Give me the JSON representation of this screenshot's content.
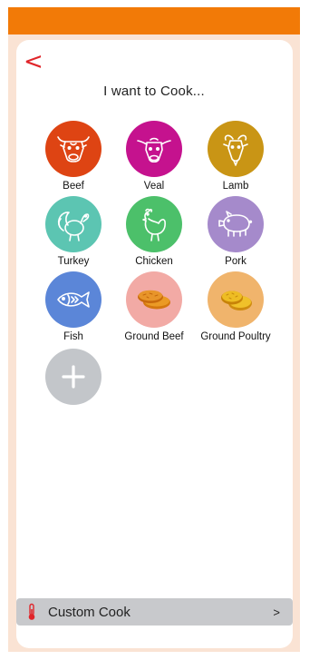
{
  "header": {
    "back_label": "<",
    "title": "I want to Cook..."
  },
  "items": [
    {
      "label": "Beef",
      "icon": "cow-icon",
      "color": "#de4413"
    },
    {
      "label": "Veal",
      "icon": "calf-icon",
      "color": "#c5128e"
    },
    {
      "label": "Lamb",
      "icon": "goat-icon",
      "color": "#c99515"
    },
    {
      "label": "Turkey",
      "icon": "turkey-icon",
      "color": "#5cc5b2"
    },
    {
      "label": "Chicken",
      "icon": "chicken-icon",
      "color": "#4cc06a"
    },
    {
      "label": "Pork",
      "icon": "pig-icon",
      "color": "#a58acb"
    },
    {
      "label": "Fish",
      "icon": "fish-icon",
      "color": "#5b86d8"
    },
    {
      "label": "Ground Beef",
      "icon": "ground-beef-patties-icon",
      "color": "#f2aaa5"
    },
    {
      "label": "Ground Poultry",
      "icon": "ground-poultry-patties-icon",
      "color": "#f0b46c"
    }
  ],
  "add_button": {
    "icon": "plus-icon",
    "color": "#c3c6ca"
  },
  "footer": {
    "label": "Custom Cook",
    "icon": "thermometer-icon",
    "chevron": ">"
  },
  "theme": {
    "accent": "#f27a07",
    "background": "#fae3d4",
    "back_color": "#e0252a"
  }
}
